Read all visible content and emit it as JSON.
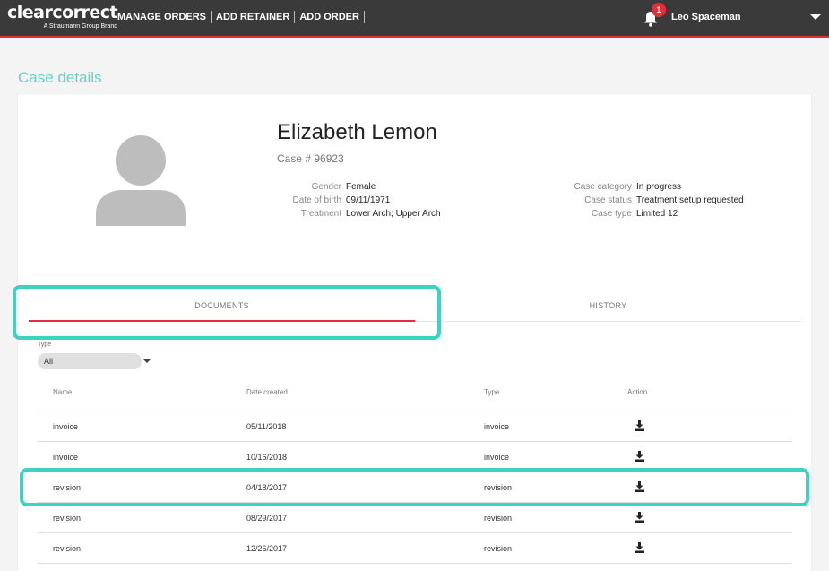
{
  "header": {
    "logo": {
      "name": "clearcorrect",
      "tagline": "A Straumann Group Brand"
    },
    "nav": [
      "MANAGE ORDERS",
      "ADD RETAINER",
      "ADD ORDER"
    ],
    "notifications": {
      "count": "1",
      "icon": "bell-icon"
    },
    "user": {
      "name": "Leo Spaceman",
      "icon": "caret-down-icon"
    }
  },
  "page": {
    "title": "Case details"
  },
  "patient": {
    "name": "Elizabeth Lemon",
    "case_number": "Case # 96923",
    "details_left": [
      {
        "label": "Gender",
        "value": "Female"
      },
      {
        "label": "Date of birth",
        "value": "09/11/1971"
      },
      {
        "label": "Treatment",
        "value": "Lower Arch; Upper Arch"
      }
    ],
    "details_right": [
      {
        "label": "Case category",
        "value": "In progress"
      },
      {
        "label": "Case status",
        "value": "Treatment setup requested"
      },
      {
        "label": "Case type",
        "value": "Limited 12"
      }
    ]
  },
  "tabs": [
    {
      "label": "DOCUMENTS",
      "active": true
    },
    {
      "label": "HISTORY",
      "active": false
    }
  ],
  "filter": {
    "label": "Type",
    "selected": "All"
  },
  "table": {
    "columns": [
      "Name",
      "Date created",
      "Type",
      "Action"
    ],
    "rows": [
      {
        "name": "invoice",
        "date": "05/11/2018",
        "type": "invoice",
        "action": "download-icon"
      },
      {
        "name": "invoice",
        "date": "10/16/2018",
        "type": "invoice",
        "action": "download-icon"
      },
      {
        "name": "revision",
        "date": "04/18/2017",
        "type": "revision",
        "action": "download-icon"
      },
      {
        "name": "revision",
        "date": "08/29/2017",
        "type": "revision",
        "action": "download-icon"
      },
      {
        "name": "revision",
        "date": "12/26/2017",
        "type": "revision",
        "action": "download-icon"
      }
    ]
  },
  "colors": {
    "accent": "#5fd3c6",
    "highlight": "#3ed2c2",
    "brand_red": "#e0313b",
    "topbar": "#3a3a3a"
  }
}
